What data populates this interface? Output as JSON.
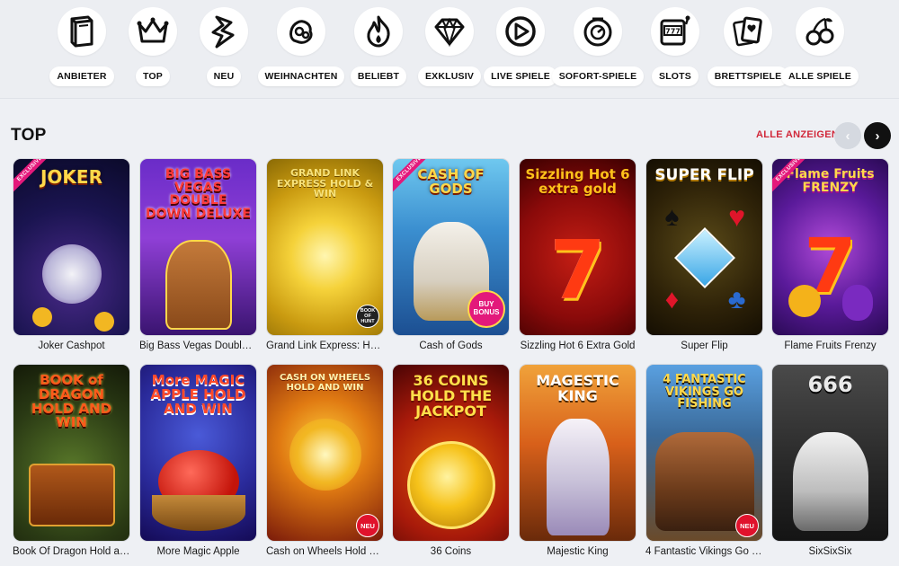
{
  "categories": [
    {
      "label": "ANBIETER",
      "icon": "book-icon"
    },
    {
      "label": "TOP",
      "icon": "crown-icon"
    },
    {
      "label": "NEU",
      "icon": "lightning-icon"
    },
    {
      "label": "WEIHNACHTEN",
      "icon": "christmas-icon"
    },
    {
      "label": "BELIEBT",
      "icon": "flame-icon"
    },
    {
      "label": "EXKLUSIV",
      "icon": "diamond-icon"
    },
    {
      "label": "LIVE SPIELE",
      "icon": "play-icon"
    },
    {
      "label": "SOFORT-SPIELE",
      "icon": "instant-icon"
    },
    {
      "label": "SLOTS",
      "icon": "slot-machine-icon"
    },
    {
      "label": "BRETTSPIELE",
      "icon": "cards-icon"
    },
    {
      "label": "ALLE SPIELE",
      "icon": "cherries-icon"
    }
  ],
  "section": {
    "title": "TOP",
    "view_all": "ALLE ANZEIGEN",
    "prev_icon": "chevron-left-icon",
    "next_icon": "chevron-right-icon"
  },
  "badges": {
    "exclusive": "EXCLUSIVE",
    "new": "NEU",
    "buy_bonus": "BUY BONUS",
    "provider": "BOOK OF HUNT"
  },
  "games_row1": [
    {
      "name": "Joker Cashpot",
      "art": "JOKER",
      "exclusive": true
    },
    {
      "name": "Big Bass Vegas Double Do...",
      "art": "BIG BASS VEGAS DOUBLE DOWN DELUXE"
    },
    {
      "name": "Grand Link Express: Hold ...",
      "art": "GRAND LINK EXPRESS HOLD & WIN"
    },
    {
      "name": "Cash of Gods",
      "art": "CASH OF GODS",
      "exclusive": true
    },
    {
      "name": "Sizzling Hot 6 Extra Gold",
      "art": "Sizzling Hot 6 extra gold"
    },
    {
      "name": "Super Flip",
      "art": "SUPER FLIP"
    },
    {
      "name": "Flame Fruits Frenzy",
      "art": "Flame Fruits FRENZY",
      "exclusive": true
    }
  ],
  "games_row2": [
    {
      "name": "Book Of Dragon Hold and ...",
      "art": "BOOK of DRAGON HOLD AND WIN"
    },
    {
      "name": "More Magic Apple",
      "art": "More MAGIC APPLE HOLD AND WIN"
    },
    {
      "name": "Cash on Wheels Hold & ...",
      "art": "CASH ON WHEELS HOLD AND WIN",
      "new": true
    },
    {
      "name": "36 Coins",
      "art": "36 COINS HOLD THE JACKPOT"
    },
    {
      "name": "Majestic King",
      "art": "MAGESTIC KING"
    },
    {
      "name": "4 Fantastic Vikings Go Fis...",
      "art": "4 FANTASTIC VIKINGS GO FISHING",
      "new": true
    },
    {
      "name": "SixSixSix",
      "art": "666"
    }
  ],
  "colors": {
    "accent": "#d1283a",
    "exclusive_badge": "#e3197b",
    "new_badge": "#e0122c"
  }
}
